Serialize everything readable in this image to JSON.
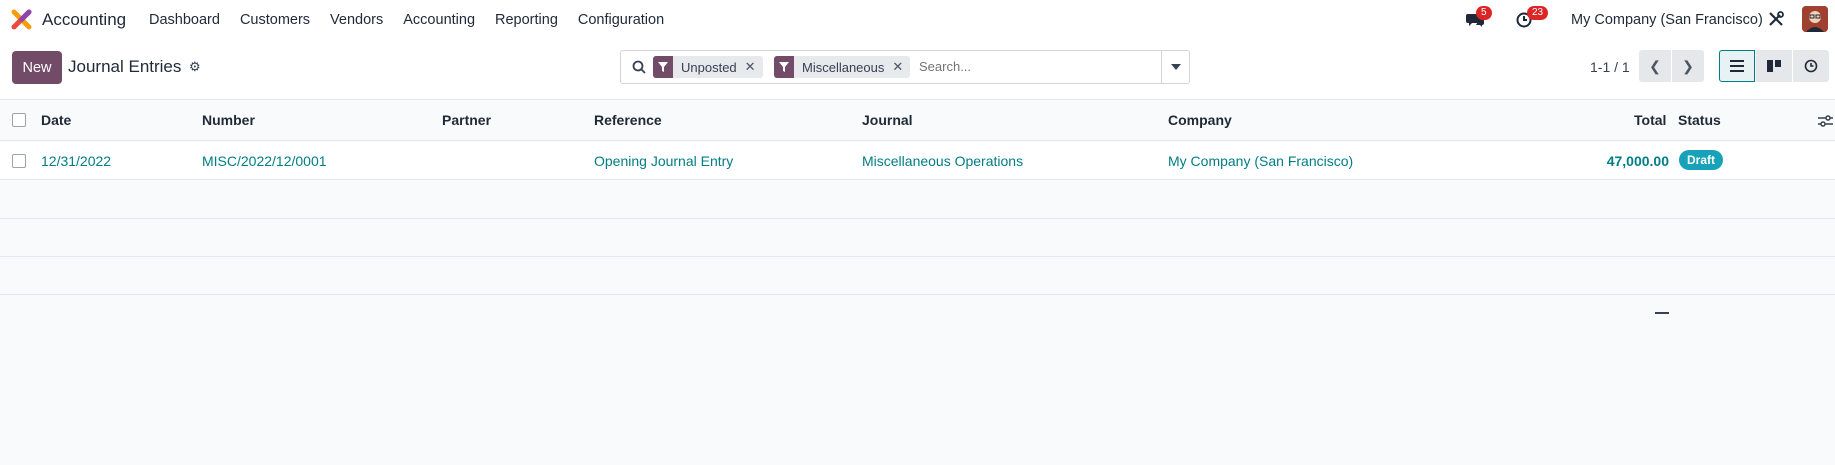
{
  "topnav": {
    "app_name": "Accounting",
    "menu": [
      "Dashboard",
      "Customers",
      "Vendors",
      "Accounting",
      "Reporting",
      "Configuration"
    ],
    "messages_count": "5",
    "activities_count": "23",
    "company": "My Company (San Francisco)"
  },
  "control_panel": {
    "new_label": "New",
    "title": "Journal Entries",
    "search": {
      "facets": [
        "Unposted",
        "Miscellaneous"
      ],
      "placeholder": "Search..."
    },
    "pager": "1-1 / 1"
  },
  "table": {
    "columns": [
      "Date",
      "Number",
      "Partner",
      "Reference",
      "Journal",
      "Company",
      "Total",
      "Status"
    ],
    "rows": [
      {
        "date": "12/31/2022",
        "number": "MISC/2022/12/0001",
        "partner": "",
        "reference": "Opening Journal Entry",
        "journal": "Miscellaneous Operations",
        "company": "My Company (San Francisco)",
        "total": "47,000.00",
        "status": "Draft"
      }
    ]
  },
  "colors": {
    "brand": "#714b67",
    "link": "#017e84",
    "badge": "#dc2626",
    "status_draft": "#17a2b8"
  },
  "icons": [
    "search-icon",
    "filter-icon",
    "gear-icon",
    "chat-icon",
    "clock-icon",
    "tools-icon",
    "list-view-icon",
    "kanban-view-icon",
    "activity-view-icon",
    "optional-columns-icon"
  ]
}
